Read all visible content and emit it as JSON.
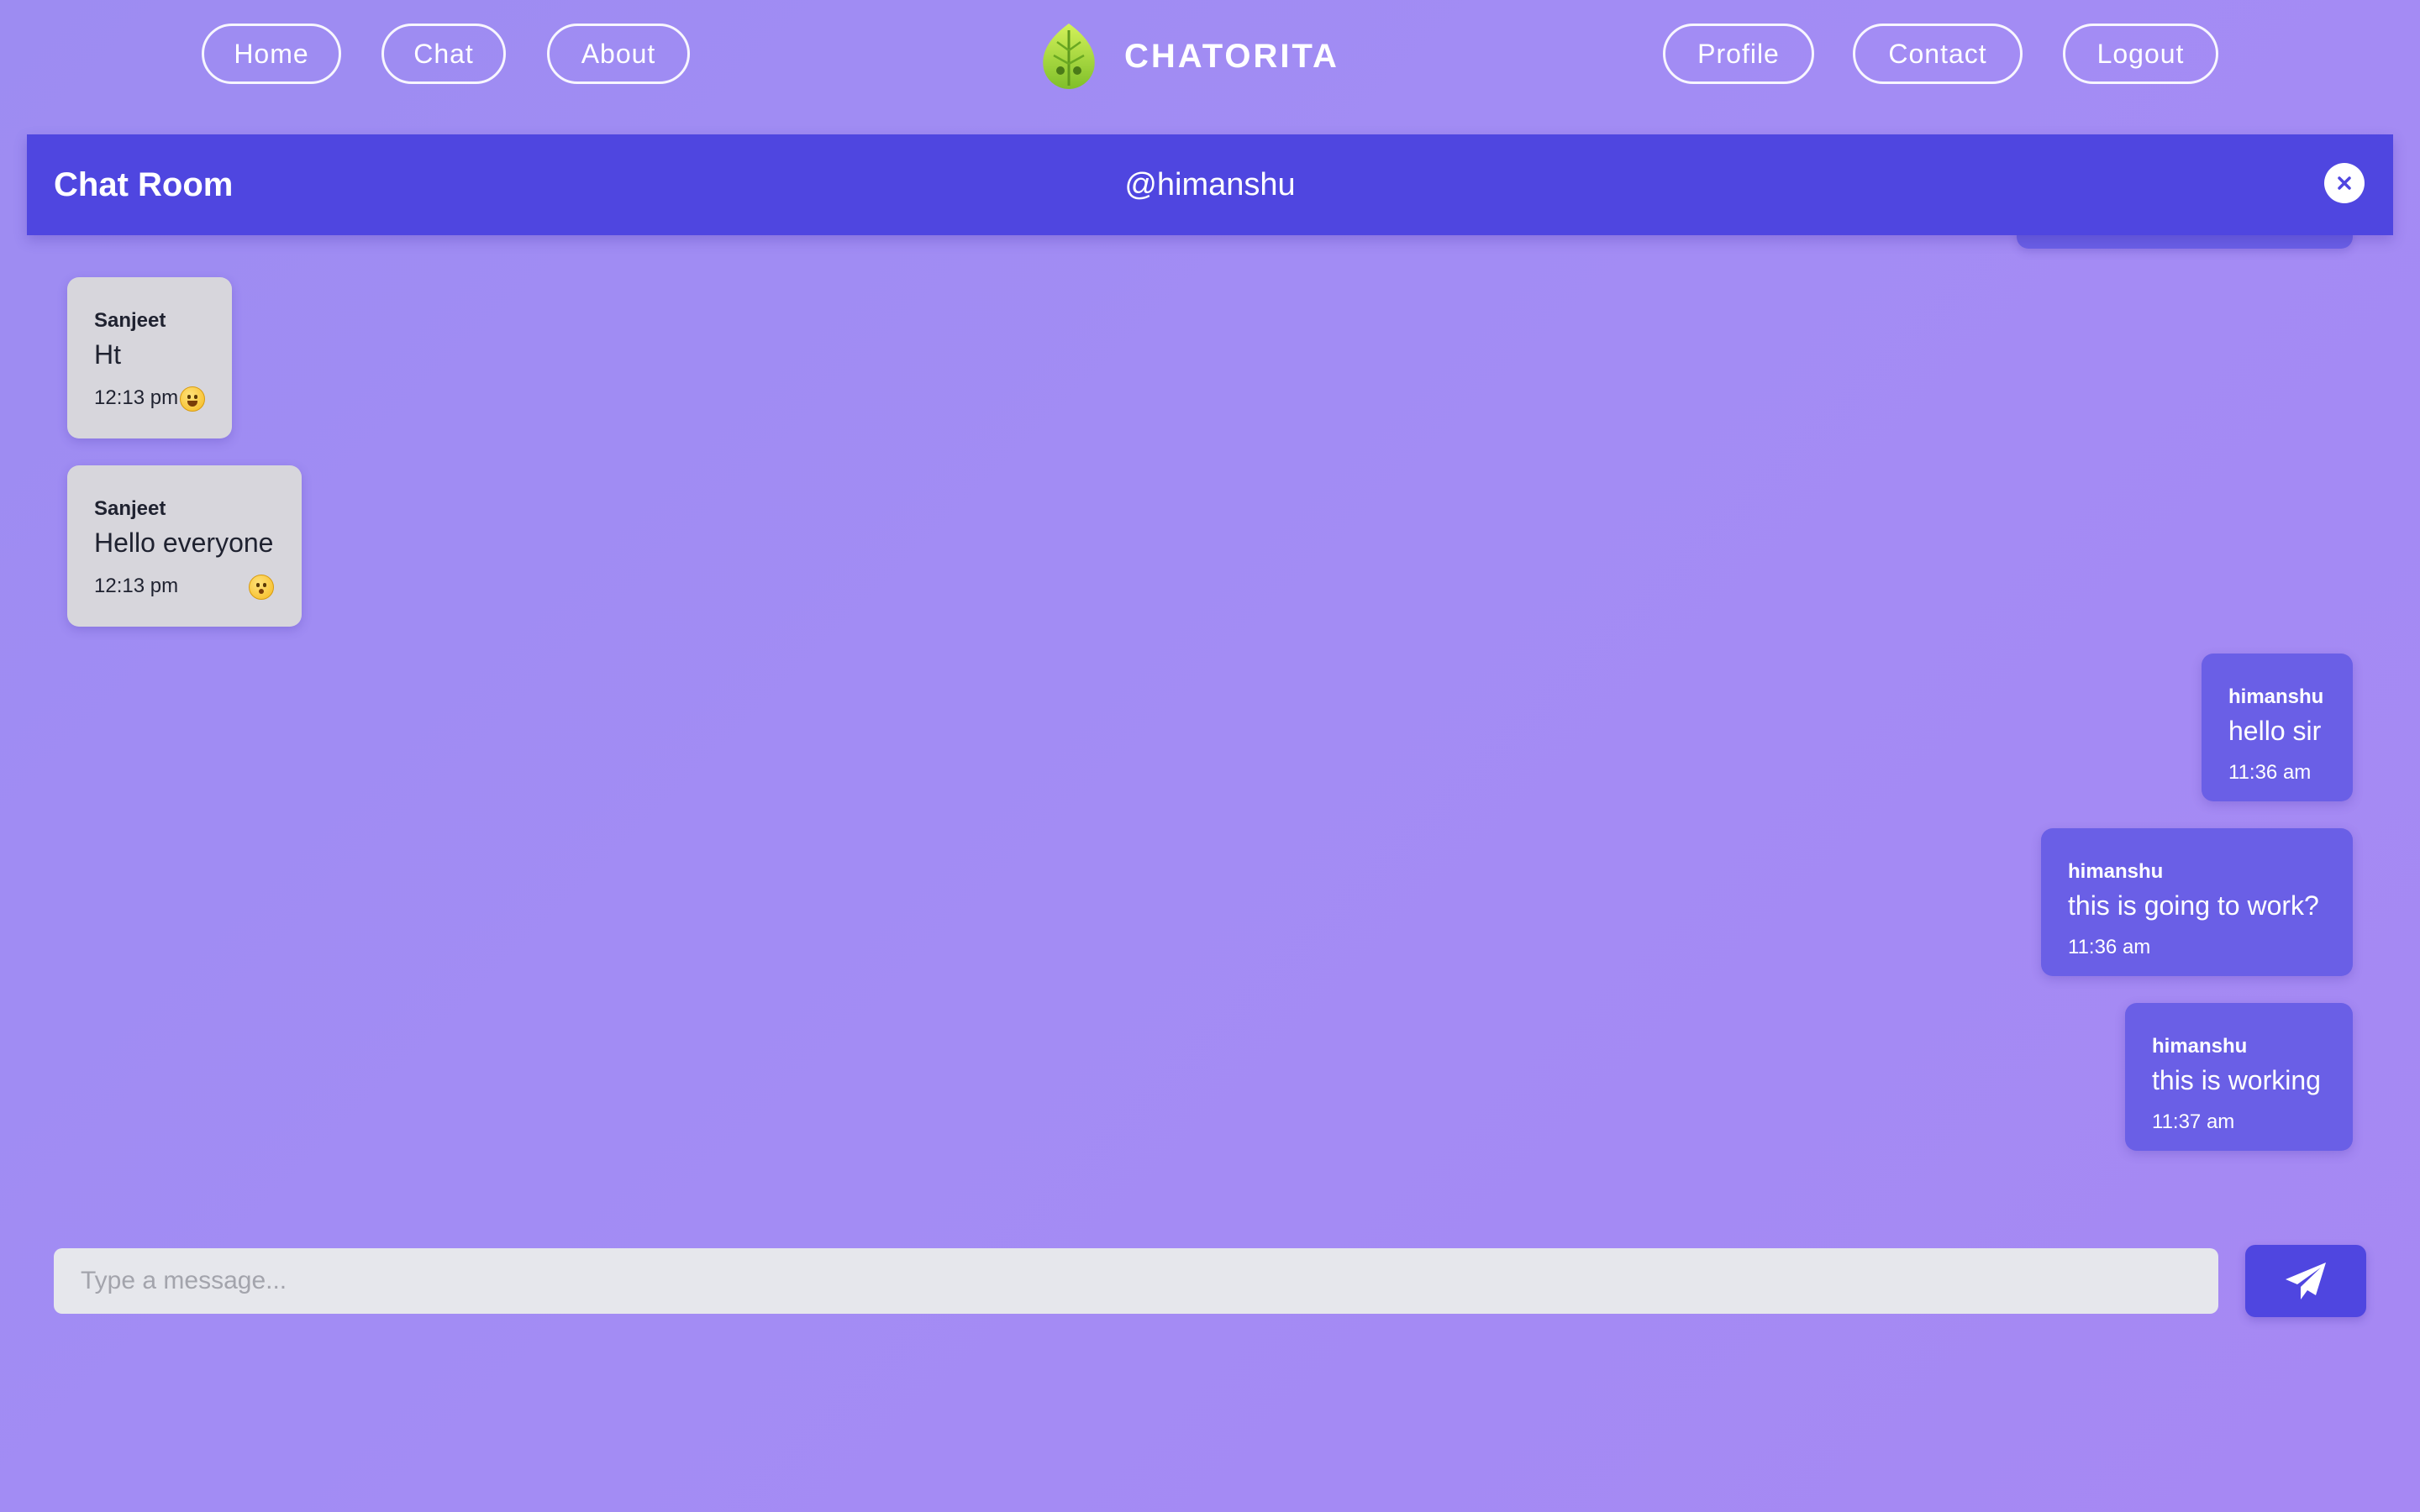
{
  "nav": {
    "left": [
      {
        "label": "Home"
      },
      {
        "label": "Chat"
      },
      {
        "label": "About"
      }
    ],
    "brand": "CHATORITA",
    "right": [
      {
        "label": "Profile"
      },
      {
        "label": "Contact"
      },
      {
        "label": "Logout"
      }
    ]
  },
  "chat": {
    "title": "Chat Room",
    "user": "@himanshu",
    "close_icon": "close-icon"
  },
  "messages": [
    {
      "direction": "incoming",
      "sender": "Sanjeet",
      "text": "Ht",
      "time": "12:13 pm",
      "emoji": "grinning-face"
    },
    {
      "direction": "incoming",
      "sender": "Sanjeet",
      "text": "Hello everyone",
      "time": "12:13 pm",
      "emoji": "kissing-face"
    },
    {
      "direction": "outgoing",
      "sender": "himanshu",
      "text": "hello sir",
      "time": "11:36 am"
    },
    {
      "direction": "outgoing",
      "sender": "himanshu",
      "text": "this is going to work?",
      "time": "11:36 am"
    },
    {
      "direction": "outgoing",
      "sender": "himanshu",
      "text": "this is working",
      "time": "11:37 am"
    }
  ],
  "composer": {
    "placeholder": "Type a message...",
    "send_icon": "paper-plane-icon"
  },
  "colors": {
    "background": "#a08bf3",
    "header": "#4f46e0",
    "outgoing_bubble": "#6a5fe6",
    "incoming_bubble": "#d7d6dc"
  }
}
